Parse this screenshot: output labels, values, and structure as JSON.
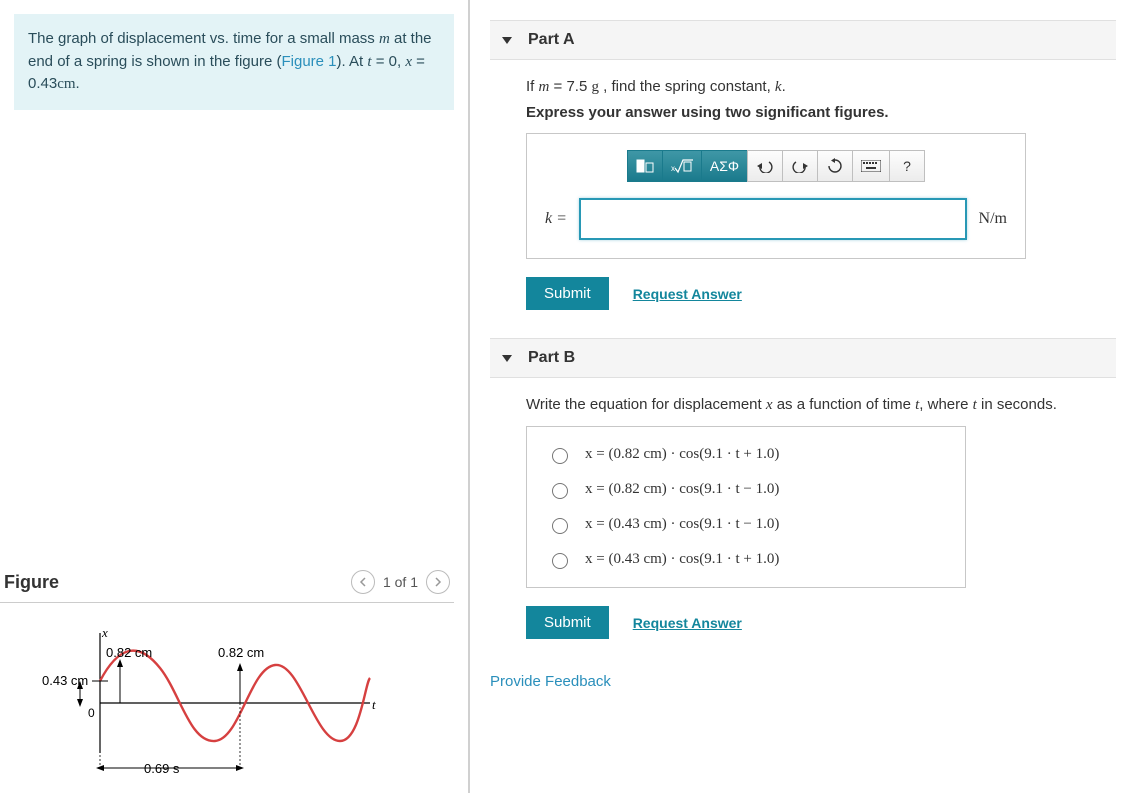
{
  "problem": {
    "text_prefix": "The graph of displacement vs. time for a small mass ",
    "m_var": "m",
    "text_mid1": " at the end of a spring is shown in the figure (",
    "figure_link": "Figure 1",
    "text_mid2": "). At ",
    "t_var": "t",
    "text_mid3": " = 0, ",
    "x_var": "x",
    "text_mid4": " = 0.43",
    "unit": "cm",
    "text_end": "."
  },
  "figure": {
    "title": "Figure",
    "page": "1 of 1",
    "labels": {
      "x_axis": "x",
      "t_axis": "t",
      "amp1": "0.82 cm",
      "amp2": "0.82 cm",
      "start": "0.43 cm",
      "origin": "0",
      "period": "0.69 s"
    }
  },
  "chart_data": {
    "type": "line",
    "title": "Displacement vs time",
    "xlabel": "t (s)",
    "ylabel": "x (cm)",
    "amplitude_cm": 0.82,
    "initial_displacement_cm": 0.43,
    "period_s": 0.69,
    "x": [
      0,
      0.069,
      0.138,
      0.207,
      0.276,
      0.345,
      0.414,
      0.483,
      0.552,
      0.621,
      0.69,
      0.759,
      0.828,
      0.897,
      0.966,
      1.035
    ],
    "y": [
      0.43,
      0.79,
      0.75,
      0.33,
      -0.28,
      -0.72,
      -0.8,
      -0.48,
      0.08,
      0.61,
      0.82,
      0.61,
      0.08,
      -0.48,
      -0.8,
      -0.72
    ]
  },
  "partA": {
    "title": "Part A",
    "instr_prefix": "If ",
    "instr_m": "m",
    "instr_mid": " = 7.5 ",
    "instr_g": "g",
    "instr_mid2": " , find the spring constant, ",
    "instr_k": "k",
    "instr_end": ".",
    "sigfigs": "Express your answer using two significant figures.",
    "toolbar": {
      "templates": "",
      "sqrt": "",
      "greek": "ΑΣΦ",
      "undo": "",
      "redo": "",
      "reset": "",
      "keyboard": "",
      "help": "?"
    },
    "eq_label": "k =",
    "unit": "N/m",
    "submit": "Submit",
    "request": "Request Answer"
  },
  "partB": {
    "title": "Part B",
    "instr_prefix": "Write the equation for displacement ",
    "instr_x": "x",
    "instr_mid": " as a function of time ",
    "instr_t": "t",
    "instr_mid2": ", where ",
    "instr_end": " in seconds.",
    "options": [
      "x = (0.82 cm) · cos(9.1 · t + 1.0)",
      "x = (0.82 cm) · cos(9.1 · t − 1.0)",
      "x = (0.43 cm) · cos(9.1 · t − 1.0)",
      "x = (0.43 cm) · cos(9.1 · t + 1.0)"
    ],
    "submit": "Submit",
    "request": "Request Answer"
  },
  "feedback": "Provide Feedback"
}
